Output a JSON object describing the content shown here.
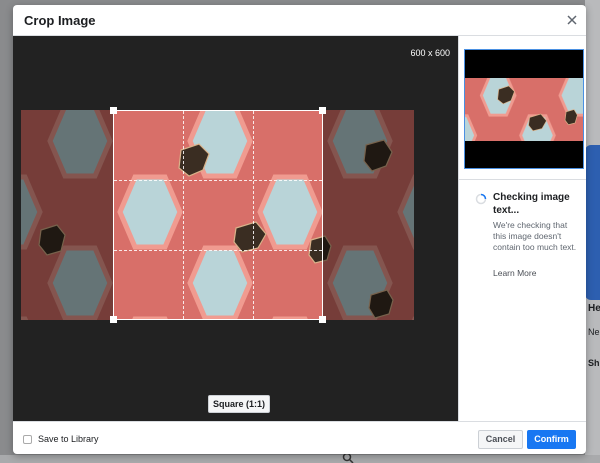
{
  "background": {
    "card_text": "He",
    "side_text_1": "Ne",
    "side_text_2": "Sh"
  },
  "modal": {
    "title": "Crop Image",
    "size_label": "600 x 600",
    "aspect_button": "Square (1:1)",
    "status": {
      "title": "Checking image text...",
      "body": "We're checking that this image doesn't contain too much text.",
      "link": "Learn More"
    },
    "footer": {
      "save_label": "Save to Library",
      "cancel": "Cancel",
      "confirm": "Confirm"
    }
  },
  "colors": {
    "accent": "#1877f2",
    "canvas": "#222222",
    "honeycomb": "#e07a72",
    "cell": "#b8d3d6"
  },
  "icons": {
    "close": "close-icon",
    "spinner": "loading-spinner-icon",
    "search": "search-icon"
  }
}
